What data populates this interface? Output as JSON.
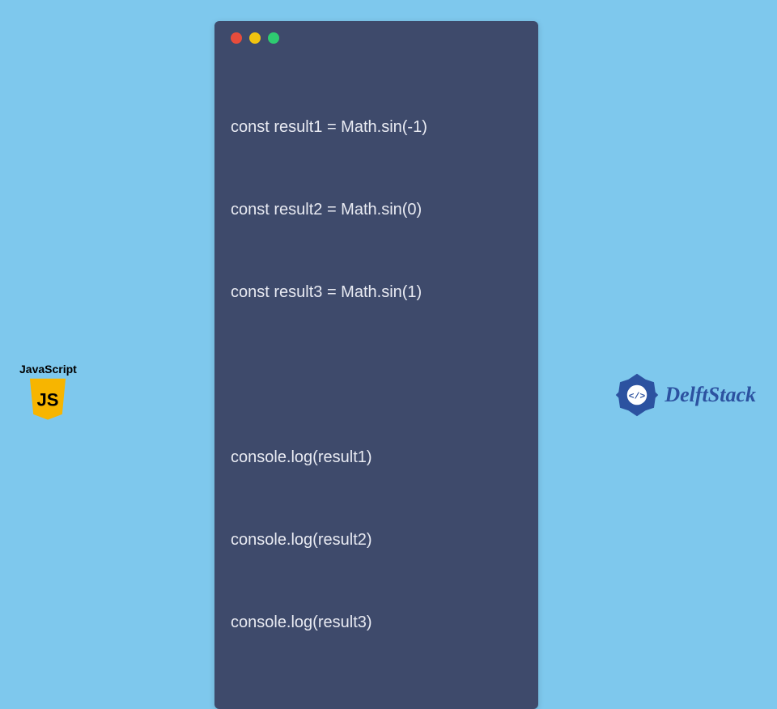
{
  "code": {
    "lines": [
      "const result1 = Math.sin(-1)",
      "const result2 = Math.sin(0)",
      "const result3 = Math.sin(1)",
      "",
      "console.log(result1)",
      "console.log(result2)",
      "console.log(result3)"
    ]
  },
  "badge": {
    "label": "JavaScript",
    "shield_text": "JS",
    "shield_bg": "#f7b500",
    "shield_fg": "#000000"
  },
  "brand": {
    "name": "DelftStack",
    "color": "#2c52a0"
  }
}
